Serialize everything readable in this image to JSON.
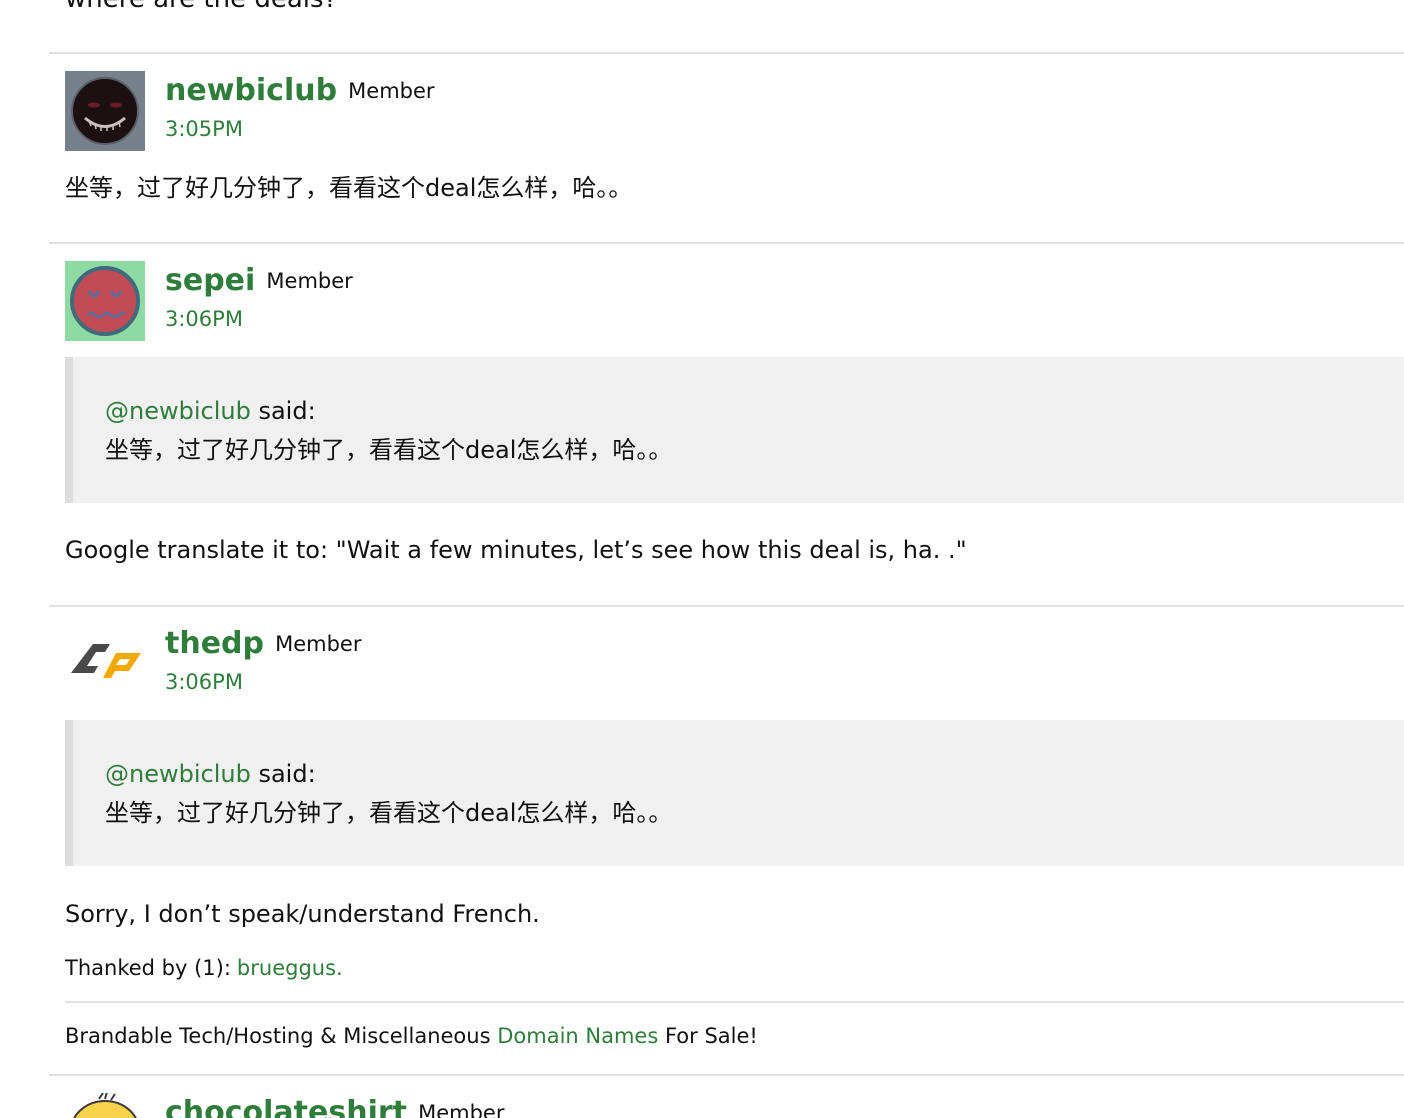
{
  "top_text": "where are the deals?",
  "comments": [
    {
      "username": "newbiclub",
      "role": "Member",
      "time": "3:05PM",
      "body": "坐等，过了好几分钟了，看看这个deal怎么样，哈。。"
    },
    {
      "username": "sepei",
      "role": "Member",
      "time": "3:06PM",
      "quote": {
        "author": "@newbiclub",
        "said": "said:",
        "text": "坐等，过了好几分钟了，看看这个deal怎么样，哈。。"
      },
      "body": "Google translate it to: \"Wait a few minutes, let’s see how this deal is, ha. .\""
    },
    {
      "username": "thedp",
      "role": "Member",
      "time": "3:06PM",
      "quote": {
        "author": "@newbiclub",
        "said": "said:",
        "text": "坐等，过了好几分钟了，看看这个deal怎么样，哈。。"
      },
      "body": "Sorry, I don’t speak/understand French.",
      "thanked_label": "Thanked by (1):",
      "thanked_users": "brueggus.",
      "signature": {
        "prefix": "Brandable Tech/Hosting & Miscellaneous",
        "link": "Domain Names",
        "suffix": "For Sale!"
      }
    },
    {
      "username": "chocolateshirt",
      "role": "Member"
    }
  ],
  "colors": {
    "link_green": "#2f7d3b",
    "quote_bg": "#f0f0f0",
    "divider": "#e2e2e2"
  },
  "icons": {
    "newbiclub_avatar": "dark-grin-face-avatar",
    "sepei_avatar": "red-sleepy-face-avatar",
    "thedp_avatar": "dp-logo-avatar",
    "chocolateshirt_avatar": "yellow-duck-avatar"
  }
}
